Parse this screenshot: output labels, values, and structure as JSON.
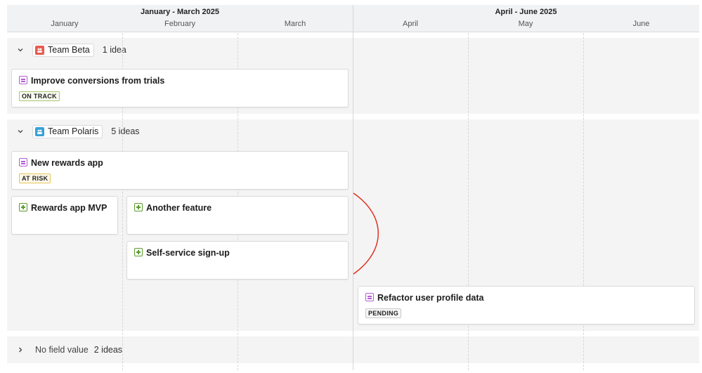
{
  "header": {
    "quarters": [
      "January - March 2025",
      "April - June 2025"
    ],
    "months": [
      "January",
      "February",
      "March",
      "April",
      "May",
      "June"
    ]
  },
  "groups": [
    {
      "team": "Team Beta",
      "count": "1 idea",
      "avatar_color": "#e85a50",
      "cards": [
        {
          "title": "Improve conversions from trials",
          "type": "idea",
          "status": "ON TRACK"
        }
      ]
    },
    {
      "team": "Team Polaris",
      "count": "5 ideas",
      "avatar_color": "#3aa0d8",
      "cards": [
        {
          "title": "New rewards app",
          "type": "idea",
          "status": "AT RISK"
        },
        {
          "title": "Rewards app MVP",
          "type": "feature",
          "status": ""
        },
        {
          "title": "Another feature",
          "type": "feature",
          "status": ""
        },
        {
          "title": "Self-service sign-up",
          "type": "feature",
          "status": ""
        },
        {
          "title": "Refactor user profile data",
          "type": "idea",
          "status": "PENDING"
        }
      ]
    },
    {
      "label": "No field value",
      "count": "2 ideas"
    }
  ],
  "colors": {
    "idea_icon": "#b45cd6",
    "feature_icon": "#5a9a2e",
    "dependency_line": "#e0301e"
  }
}
